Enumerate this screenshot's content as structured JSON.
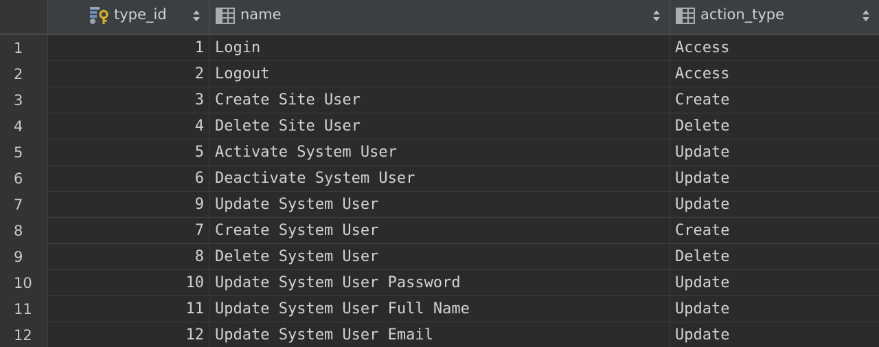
{
  "columns": {
    "type_id": "type_id",
    "name": "name",
    "action_type": "action_type"
  },
  "icons": {
    "type_id": "primary-key-column-icon",
    "name": "column-icon",
    "action_type": "column-icon"
  },
  "rows": [
    {
      "num": "1",
      "type_id": "1",
      "name": "Login",
      "action_type": "Access"
    },
    {
      "num": "2",
      "type_id": "2",
      "name": "Logout",
      "action_type": "Access"
    },
    {
      "num": "3",
      "type_id": "3",
      "name": "Create Site User",
      "action_type": "Create"
    },
    {
      "num": "4",
      "type_id": "4",
      "name": "Delete Site User",
      "action_type": "Delete"
    },
    {
      "num": "5",
      "type_id": "5",
      "name": "Activate System User",
      "action_type": "Update"
    },
    {
      "num": "6",
      "type_id": "6",
      "name": "Deactivate System User",
      "action_type": "Update"
    },
    {
      "num": "7",
      "type_id": "9",
      "name": "Update System User",
      "action_type": "Update"
    },
    {
      "num": "8",
      "type_id": "7",
      "name": "Create System User",
      "action_type": "Create"
    },
    {
      "num": "9",
      "type_id": "8",
      "name": "Delete System User",
      "action_type": "Delete"
    },
    {
      "num": "10",
      "type_id": "10",
      "name": "Update System User Password",
      "action_type": "Update"
    },
    {
      "num": "11",
      "type_id": "11",
      "name": "Update System User Full Name",
      "action_type": "Update"
    },
    {
      "num": "12",
      "type_id": "12",
      "name": "Update System User Email",
      "action_type": "Update"
    }
  ]
}
